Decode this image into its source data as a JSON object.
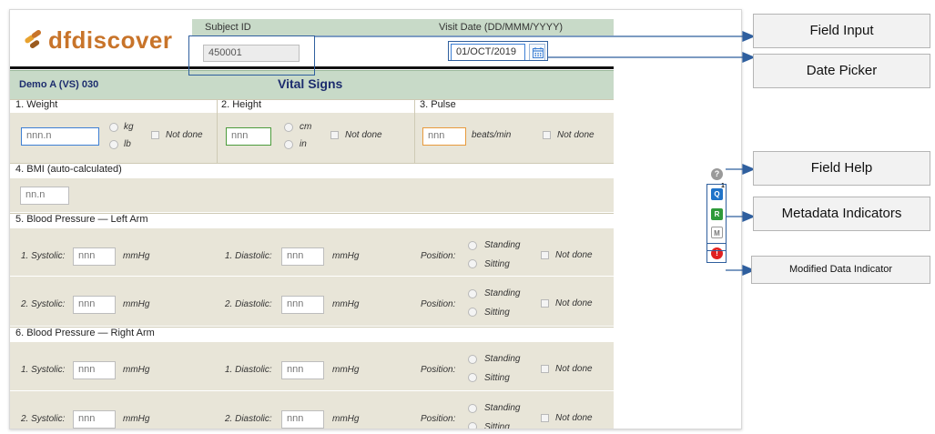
{
  "header": {
    "logo_text": "dfdiscover",
    "subject_id_label": "Subject ID",
    "subject_id_value": "450001",
    "visit_date_label": "Visit Date (DD/MMM/YYYY)",
    "visit_date_value": "01/OCT/2019",
    "calendar_icon": "calendar-icon"
  },
  "form": {
    "id": "Demo A (VS) 030",
    "title": "Vital Signs"
  },
  "weight": {
    "label": "1.  Weight",
    "placeholder": "nnn.n",
    "unit1": "kg",
    "unit2": "lb",
    "not_done": "Not done"
  },
  "height": {
    "label": "2.  Height",
    "placeholder": "nnn",
    "unit1": "cm",
    "unit2": "in",
    "not_done": "Not done"
  },
  "pulse": {
    "label": "3.  Pulse",
    "placeholder": "nnn",
    "unit": "beats/min",
    "not_done": "Not done"
  },
  "bmi": {
    "label": "4.  BMI (auto-calculated)",
    "placeholder": "nn.n"
  },
  "bp_left": {
    "label": "5.  Blood Pressure — Left Arm",
    "rows": [
      {
        "systolic": "1. Systolic:",
        "diastolic": "1. Diastolic:",
        "placeholder": "nnn",
        "unit": "mmHg",
        "position": "Position:",
        "standing": "Standing",
        "sitting": "Sitting",
        "not_done": "Not done"
      },
      {
        "systolic": "2. Systolic:",
        "diastolic": "2. Diastolic:",
        "placeholder": "nnn",
        "unit": "mmHg",
        "position": "Position:",
        "standing": "Standing",
        "sitting": "Sitting",
        "not_done": "Not done"
      }
    ]
  },
  "bp_right": {
    "label": "6.  Blood Pressure — Right Arm",
    "rows": [
      {
        "systolic": "1. Systolic:",
        "diastolic": "1. Diastolic:",
        "placeholder": "nnn",
        "unit": "mmHg",
        "position": "Position:",
        "standing": "Standing",
        "sitting": "Sitting",
        "not_done": "Not done"
      },
      {
        "systolic": "2. Systolic:",
        "diastolic": "2. Diastolic:",
        "placeholder": "nnn",
        "unit": "mmHg",
        "position": "Position:",
        "standing": "Standing",
        "sitting": "Sitting",
        "not_done": "Not done"
      }
    ]
  },
  "indicators": {
    "help": "?",
    "query": "Q",
    "query_count": "1",
    "reason": "R",
    "missing": "M",
    "modified": "!",
    "colors": {
      "help": "#9a9a9a",
      "query": "#1f73c9",
      "reason": "#2e9a3a",
      "missing": "#ffffff",
      "modified": "#e02020"
    }
  },
  "callouts": {
    "field_input": "Field Input",
    "date_picker": "Date Picker",
    "field_help": "Field Help",
    "metadata": "Metadata Indicators",
    "modified": "Modified Data Indicator"
  },
  "colors": {
    "header_green": "#c8dac8",
    "section_bg": "#e8e5d8",
    "title_navy": "#1d2d6e",
    "logo_orange": "#c8742a",
    "callout_line": "#2f5f9e"
  }
}
